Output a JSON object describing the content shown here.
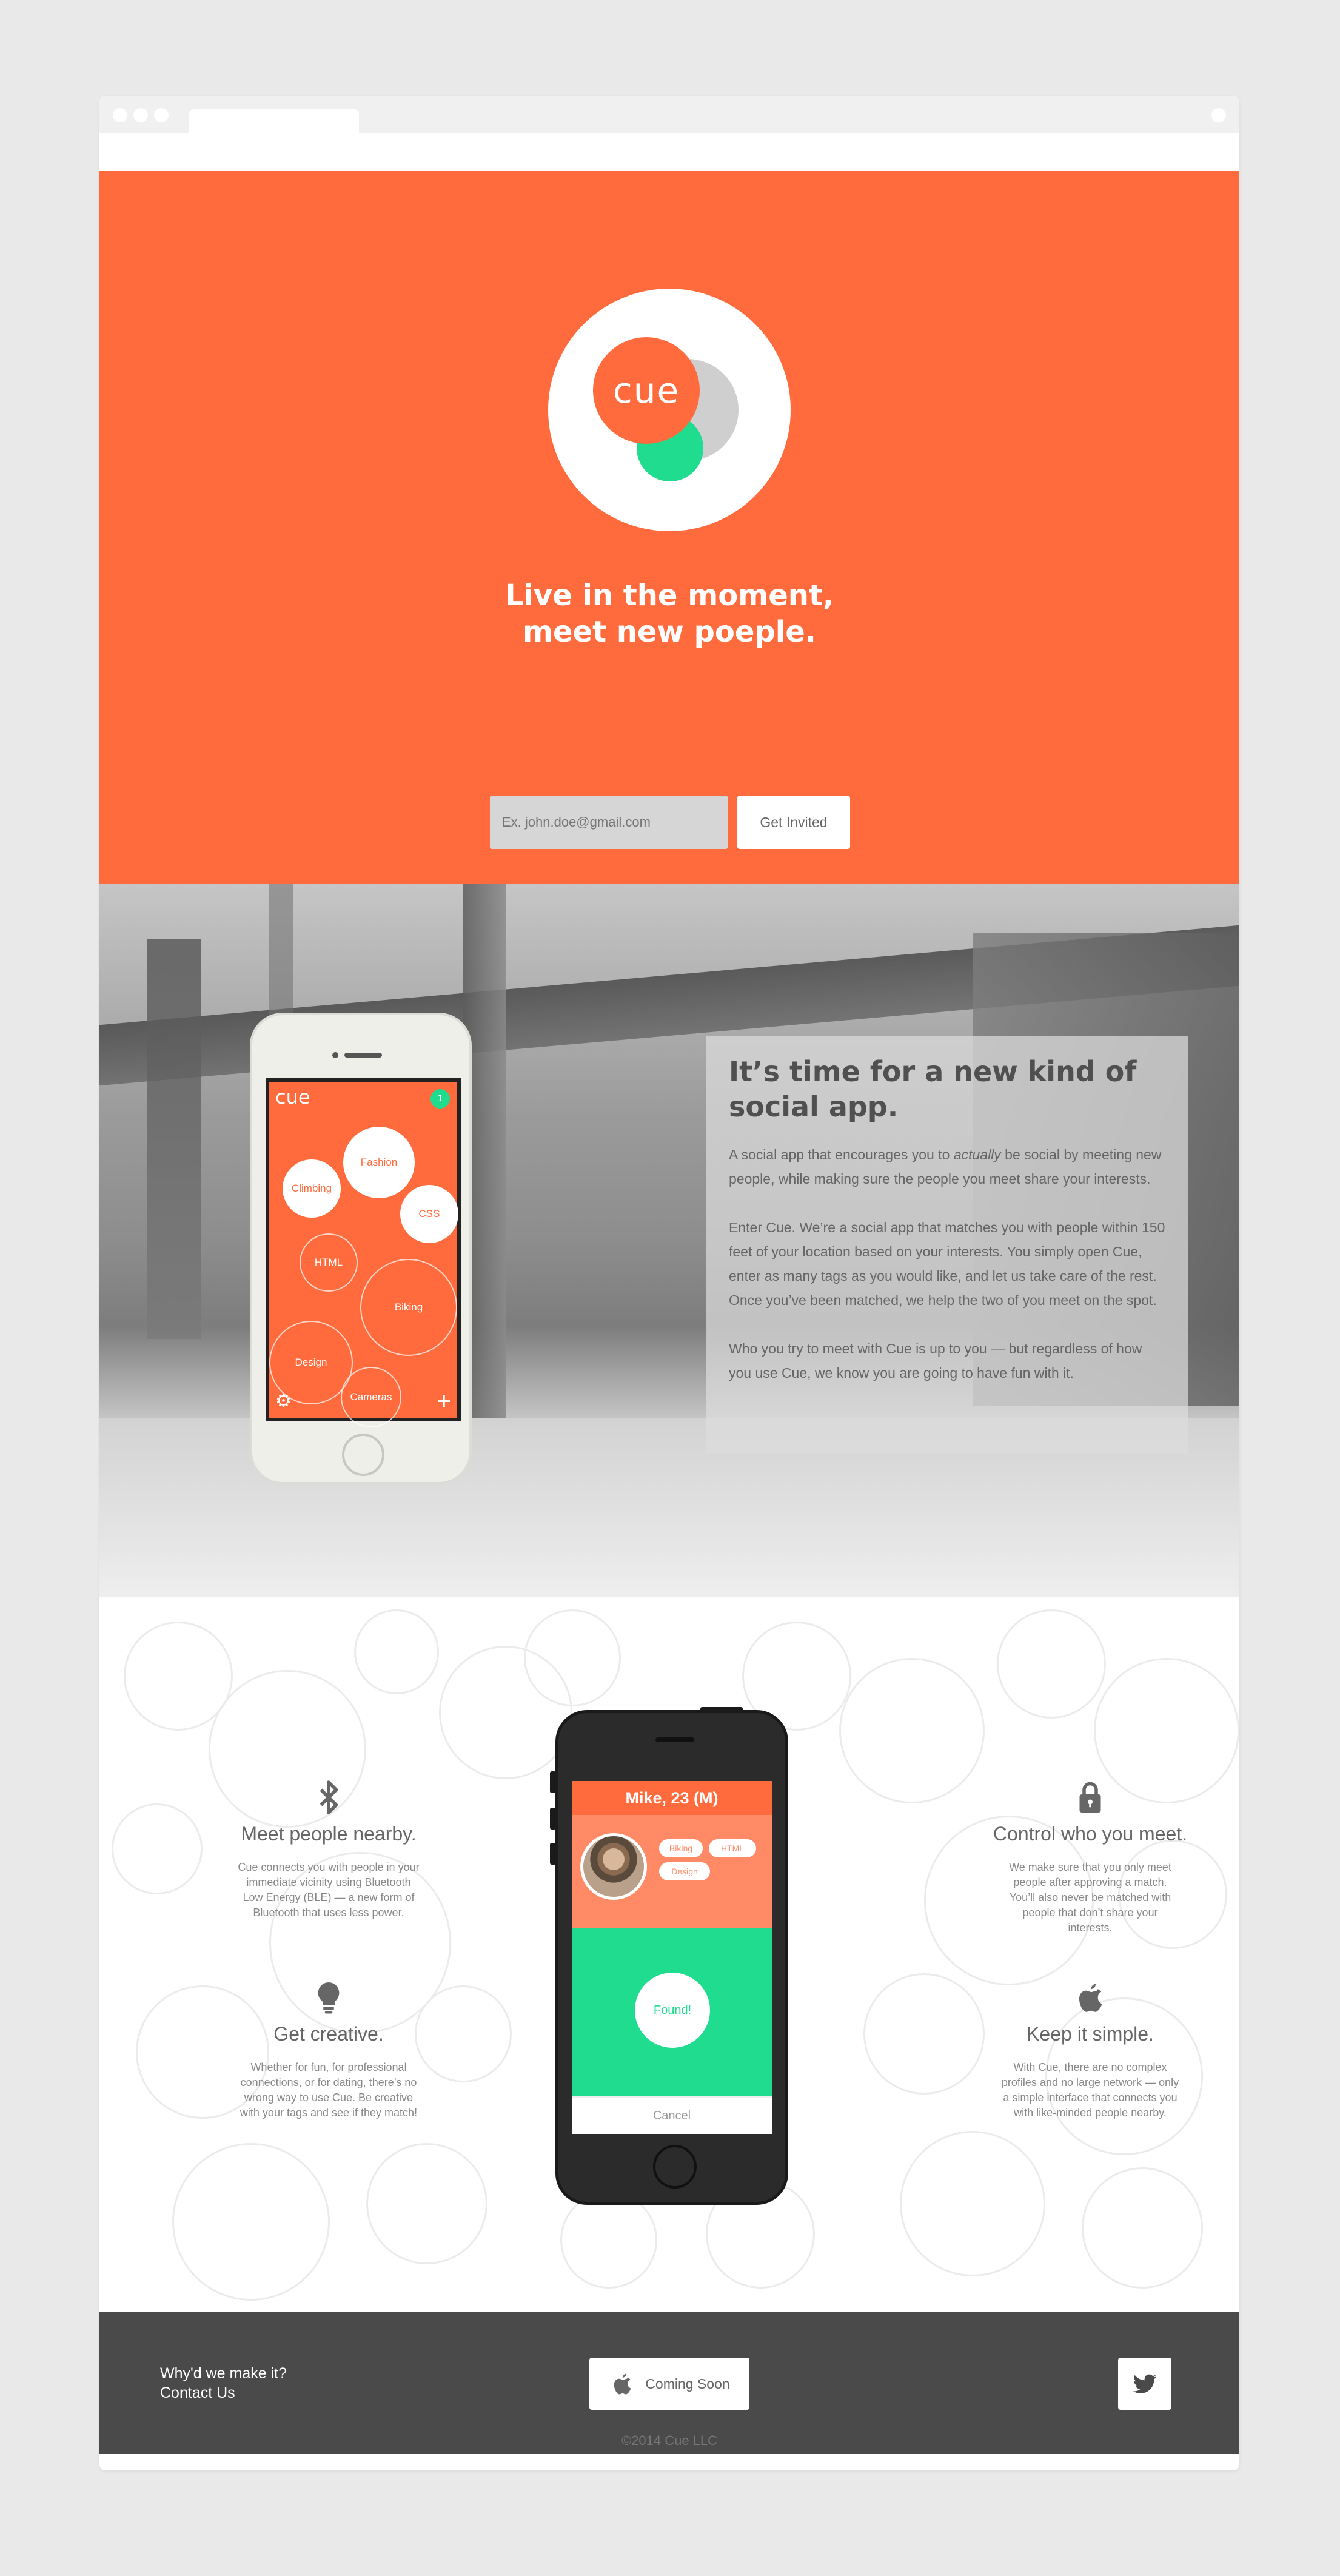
{
  "hero": {
    "logo_text": "cue",
    "title_line1": "Live in the moment,",
    "title_line2": "meet new poeple.",
    "email_placeholder": "Ex. john.doe@gmail.com",
    "invite_label": "Get Invited"
  },
  "app_screen1": {
    "logo": "cue",
    "badge": "1",
    "tags": [
      "Fashion",
      "Climbing",
      "CSS",
      "HTML",
      "Biking",
      "Design",
      "Cameras"
    ]
  },
  "about": {
    "heading_line1": "It’s time for a new kind of",
    "heading_line2": "social app.",
    "p1_a": "A social app that encourages you to ",
    "p1_em": "actually",
    "p1_b": " be social by meeting new people, while making sure the people you meet share your interests.",
    "p2": "Enter Cue. We’re a social app that matches you with people within 150 feet of your location based on your interests. You simply open Cue, enter as many tags as you would like, and let us take care of the rest. Once you’ve been matched, we help the two of you meet on the spot.",
    "p3": "Who you try to meet with Cue is up to you — but regardless of how you use Cue, we know you are going to have fun with it."
  },
  "features": [
    {
      "icon": "bluetooth-icon",
      "title": "Meet people nearby.",
      "text": "Cue connects you with people in your immediate vicinity using Bluetooth Low Energy (BLE) — a new form of Bluetooth that uses less power."
    },
    {
      "icon": "lock-icon",
      "title": "Control who you meet.",
      "text": "We make sure that you only meet people after approving a match. You’ll also never be matched with people that don’t share your interests."
    },
    {
      "icon": "lightbulb-icon",
      "title": "Get creative.",
      "text": "Whether for fun, for professional connections, or for dating, there’s no wrong way to use Cue. Be creative with your tags and see if they match!"
    },
    {
      "icon": "apple-icon",
      "title": "Keep it simple.",
      "text": "With Cue, there are no complex profiles and no large network — only a simple interface that connects you with like-minded people nearby."
    }
  ],
  "app_screen2": {
    "header": "Mike, 23 (M)",
    "tags": [
      "Biking",
      "HTML",
      "Design"
    ],
    "found_label": "Found!",
    "cancel_label": "Cancel"
  },
  "footer": {
    "link1": "Why'd we make it?",
    "link2": "Contact Us",
    "coming_soon": "Coming Soon",
    "copyright": "©2014 Cue LLC"
  },
  "colors": {
    "brand_orange": "#ff6b3d",
    "accent_green": "#1fdc8f",
    "footer_gray": "#4a4a4a"
  }
}
